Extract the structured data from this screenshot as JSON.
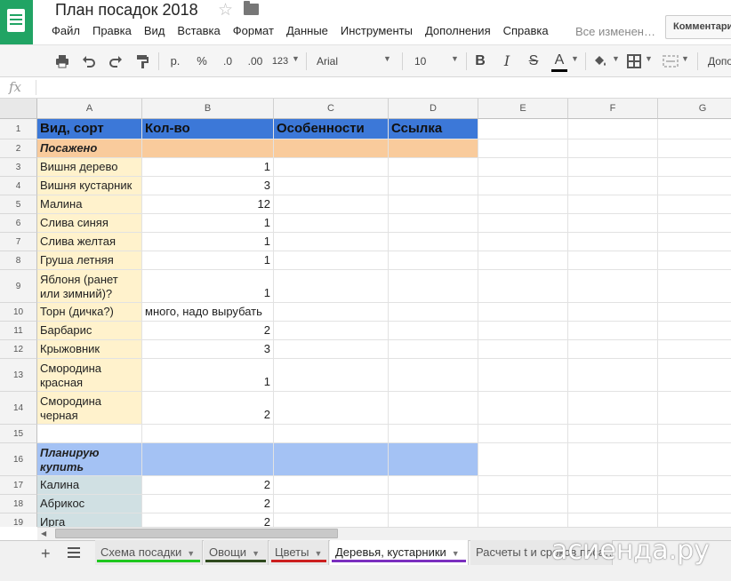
{
  "doc": {
    "title": "План посадок 2018",
    "saved_status": "Все изменен…"
  },
  "menu": [
    "Файл",
    "Правка",
    "Вид",
    "Вставка",
    "Формат",
    "Данные",
    "Инструменты",
    "Дополнения",
    "Справка"
  ],
  "comments_label": "Комментарии",
  "toolbar": {
    "currency": "р.",
    "percent": "%",
    "dec_less": ".0",
    "dec_more": ".00",
    "more_formats": "123",
    "font": "Arial",
    "font_size": "10",
    "bold": "B",
    "italic": "I",
    "strike": "S",
    "text_color": "A",
    "text_color_value": "#000000",
    "more": "Допо"
  },
  "formula_bar": {
    "label": "fx",
    "value": ""
  },
  "columns": [
    "A",
    "B",
    "C",
    "D",
    "E",
    "F",
    "G"
  ],
  "rows": [
    {
      "n": "1",
      "a": "Вид, сорт",
      "b": "Кол-во",
      "c": "Особенности",
      "d": "Ссылка"
    },
    {
      "n": "2",
      "a": "Посажено",
      "b": "",
      "c": "",
      "d": ""
    },
    {
      "n": "3",
      "a": "Вишня дерево",
      "b": "1"
    },
    {
      "n": "4",
      "a": "Вишня кустарник",
      "b": "3"
    },
    {
      "n": "5",
      "a": "Малина",
      "b": "12"
    },
    {
      "n": "6",
      "a": "Слива синяя",
      "b": "1"
    },
    {
      "n": "7",
      "a": "Слива желтая",
      "b": "1"
    },
    {
      "n": "8",
      "a": "Груша летняя",
      "b": "1"
    },
    {
      "n": "9",
      "a": "Яблоня (ранет или зимний)?",
      "b": "1"
    },
    {
      "n": "10",
      "a": "Торн (дичка?)",
      "b": "много, надо вырубать"
    },
    {
      "n": "11",
      "a": "Барбарис",
      "b": "2"
    },
    {
      "n": "12",
      "a": "Крыжовник",
      "b": "3"
    },
    {
      "n": "13",
      "a": "Смородина красная",
      "b": "1"
    },
    {
      "n": "14",
      "a": "Смородина черная",
      "b": "2"
    },
    {
      "n": "15",
      "a": "",
      "b": ""
    },
    {
      "n": "16",
      "a": "Планирую купить",
      "b": ""
    },
    {
      "n": "17",
      "a": "Калина",
      "b": "2"
    },
    {
      "n": "18",
      "a": "Абрикос",
      "b": "2"
    },
    {
      "n": "19",
      "a": "Ирга",
      "b": "2"
    }
  ],
  "colors": {
    "header_blue": "#3c78d8",
    "planted_orange": "#f9cb9c",
    "plan_blue": "#a4c2f4",
    "yellow": "#fff2cc",
    "teal": "#d0e0e3",
    "logo_green": "#21a464"
  },
  "tabs": [
    {
      "label": "Схема посадки",
      "color": "#1fc71f"
    },
    {
      "label": "Овощи",
      "color": "#2f4a1e"
    },
    {
      "label": "Цветы",
      "color": "#cc1f1f"
    },
    {
      "label": "Деревья, кустарники",
      "color": "#7b2fbf"
    },
    {
      "label": "Расчеты t и сроков поса…",
      "color": ""
    }
  ],
  "watermark": "асиенда.ру"
}
